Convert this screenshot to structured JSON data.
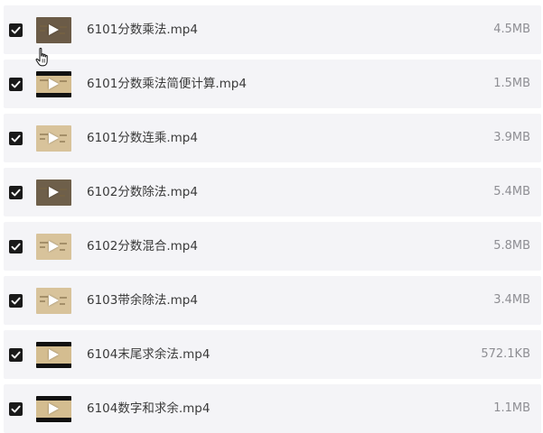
{
  "files": [
    {
      "name": "6101分数乘法.mp4",
      "size": "4.5MB",
      "checked": true,
      "thumb_color": "#6b5b47"
    },
    {
      "name": "6101分数乘法简便计算.mp4",
      "size": "1.5MB",
      "checked": true,
      "thumb_color": "#d4bd90"
    },
    {
      "name": "6101分数连乘.mp4",
      "size": "3.9MB",
      "checked": true,
      "thumb_color": "#d8c39b"
    },
    {
      "name": "6102分数除法.mp4",
      "size": "5.4MB",
      "checked": true,
      "thumb_color": "#6e5f4a"
    },
    {
      "name": "6102分数混合.mp4",
      "size": "5.8MB",
      "checked": true,
      "thumb_color": "#d8c39b"
    },
    {
      "name": "6103带余除法.mp4",
      "size": "3.4MB",
      "checked": true,
      "thumb_color": "#d8c39b"
    },
    {
      "name": "6104末尾求余法.mp4",
      "size": "572.1KB",
      "checked": true,
      "thumb_color": "#d4bd90"
    },
    {
      "name": "6104数字和求余.mp4",
      "size": "1.1MB",
      "checked": true,
      "thumb_color": "#d4bd90"
    }
  ],
  "colors": {
    "row_bg": "#f4f4f7",
    "checkbox": "#1a1a1a",
    "name_text": "#3a3a3a",
    "size_text": "#8e8e93"
  },
  "icons": {
    "checkbox": "check-icon",
    "thumbnail": "play-icon",
    "cursor": "hand-pointer-icon"
  }
}
